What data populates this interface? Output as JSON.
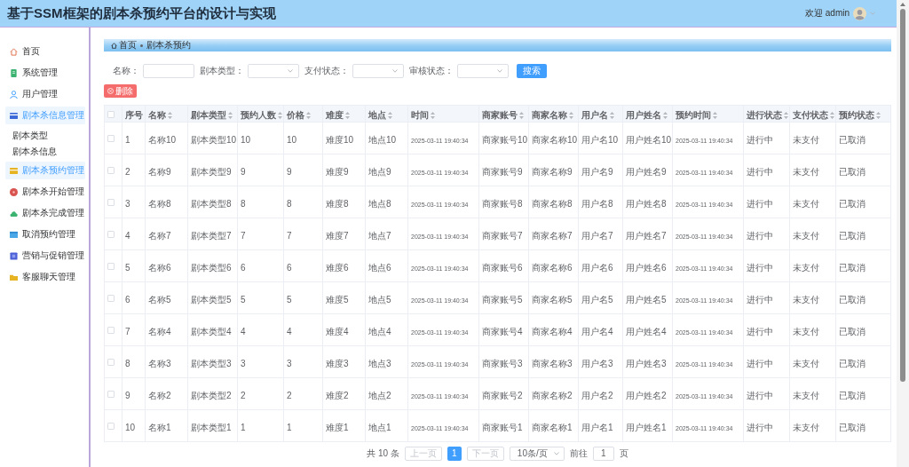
{
  "header": {
    "title": "基于SSM框架的剧本杀预约平台的设计与实现",
    "welcome": "欢迎 admin"
  },
  "sidebar": {
    "items": [
      {
        "label": "首页",
        "selected": false
      },
      {
        "label": "系统管理",
        "selected": false
      },
      {
        "label": "用户管理",
        "selected": false
      },
      {
        "label": "剧本杀信息管理",
        "selected": true,
        "expanded": true,
        "children": [
          {
            "label": "剧本类型"
          },
          {
            "label": "剧本杀信息"
          }
        ]
      },
      {
        "label": "剧本杀预约管理",
        "selected": true
      },
      {
        "label": "剧本杀开始管理",
        "selected": false
      },
      {
        "label": "剧本杀完成管理",
        "selected": false
      },
      {
        "label": "取消预约管理",
        "selected": false
      },
      {
        "label": "营销与促销管理",
        "selected": false
      },
      {
        "label": "客服聊天管理",
        "selected": false
      }
    ]
  },
  "breadcrumb": {
    "home": "首页",
    "current": "剧本杀预约"
  },
  "filters": [
    {
      "label": "名称：",
      "kind": "input"
    },
    {
      "label": "剧本类型：",
      "kind": "select"
    },
    {
      "label": "支付状态：",
      "kind": "select"
    },
    {
      "label": "审核状态：",
      "kind": "select"
    }
  ],
  "search_button": "搜索",
  "delete_button": "删除",
  "table": {
    "header_checked": false,
    "columns": [
      {
        "label": "序号",
        "sortable": false,
        "kind": "text"
      },
      {
        "label": "名称",
        "sortable": true,
        "kind": "text"
      },
      {
        "label": "剧本类型",
        "sortable": true,
        "kind": "text"
      },
      {
        "label": "预约人数",
        "sortable": true,
        "kind": "text"
      },
      {
        "label": "价格",
        "sortable": true,
        "kind": "text"
      },
      {
        "label": "难度",
        "sortable": true,
        "kind": "text"
      },
      {
        "label": "地点",
        "sortable": true,
        "kind": "text"
      },
      {
        "label": "时间",
        "sortable": true,
        "kind": "datetime"
      },
      {
        "label": "商家账号",
        "sortable": true,
        "kind": "text"
      },
      {
        "label": "商家名称",
        "sortable": true,
        "kind": "text"
      },
      {
        "label": "用户名",
        "sortable": true,
        "kind": "text"
      },
      {
        "label": "用户姓名",
        "sortable": true,
        "kind": "text"
      },
      {
        "label": "预约时间",
        "sortable": true,
        "kind": "datetime"
      },
      {
        "label": "进行状态",
        "sortable": true,
        "kind": "text"
      },
      {
        "label": "支付状态",
        "sortable": true,
        "kind": "text"
      },
      {
        "label": "预约状态",
        "sortable": true,
        "kind": "text"
      }
    ],
    "rows": [
      {
        "checked": false,
        "cells": [
          "1",
          "名称10",
          "剧本类型10",
          "10",
          "10",
          "难度10",
          "地点10",
          "2025-03-11 19:40:34",
          "商家账号10",
          "商家名称10",
          "用户名10",
          "用户姓名10",
          "2025-03-11 19:40:34",
          "进行中",
          "未支付",
          "已取消"
        ]
      },
      {
        "checked": false,
        "cells": [
          "2",
          "名称9",
          "剧本类型9",
          "9",
          "9",
          "难度9",
          "地点9",
          "2025-03-11 19:40:34",
          "商家账号9",
          "商家名称9",
          "用户名9",
          "用户姓名9",
          "2025-03-11 19:40:34",
          "进行中",
          "未支付",
          "已取消"
        ]
      },
      {
        "checked": false,
        "cells": [
          "3",
          "名称8",
          "剧本类型8",
          "8",
          "8",
          "难度8",
          "地点8",
          "2025-03-11 19:40:34",
          "商家账号8",
          "商家名称8",
          "用户名8",
          "用户姓名8",
          "2025-03-11 19:40:34",
          "进行中",
          "未支付",
          "已取消"
        ]
      },
      {
        "checked": false,
        "cells": [
          "4",
          "名称7",
          "剧本类型7",
          "7",
          "7",
          "难度7",
          "地点7",
          "2025-03-11 19:40:34",
          "商家账号7",
          "商家名称7",
          "用户名7",
          "用户姓名7",
          "2025-03-11 19:40:34",
          "进行中",
          "未支付",
          "已取消"
        ]
      },
      {
        "checked": false,
        "cells": [
          "5",
          "名称6",
          "剧本类型6",
          "6",
          "6",
          "难度6",
          "地点6",
          "2025-03-11 19:40:34",
          "商家账号6",
          "商家名称6",
          "用户名6",
          "用户姓名6",
          "2025-03-11 19:40:34",
          "进行中",
          "未支付",
          "已取消"
        ]
      },
      {
        "checked": false,
        "cells": [
          "6",
          "名称5",
          "剧本类型5",
          "5",
          "5",
          "难度5",
          "地点5",
          "2025-03-11 19:40:34",
          "商家账号5",
          "商家名称5",
          "用户名5",
          "用户姓名5",
          "2025-03-11 19:40:34",
          "进行中",
          "未支付",
          "已取消"
        ]
      },
      {
        "checked": false,
        "cells": [
          "7",
          "名称4",
          "剧本类型4",
          "4",
          "4",
          "难度4",
          "地点4",
          "2025-03-11 19:40:34",
          "商家账号4",
          "商家名称4",
          "用户名4",
          "用户姓名4",
          "2025-03-11 19:40:34",
          "进行中",
          "未支付",
          "已取消"
        ]
      },
      {
        "checked": false,
        "cells": [
          "8",
          "名称3",
          "剧本类型3",
          "3",
          "3",
          "难度3",
          "地点3",
          "2025-03-11 19:40:34",
          "商家账号3",
          "商家名称3",
          "用户名3",
          "用户姓名3",
          "2025-03-11 19:40:34",
          "进行中",
          "未支付",
          "已取消"
        ]
      },
      {
        "checked": false,
        "cells": [
          "9",
          "名称2",
          "剧本类型2",
          "2",
          "2",
          "难度2",
          "地点2",
          "2025-03-11 19:40:34",
          "商家账号2",
          "商家名称2",
          "用户名2",
          "用户姓名2",
          "2025-03-11 19:40:34",
          "进行中",
          "未支付",
          "已取消"
        ]
      },
      {
        "checked": false,
        "cells": [
          "10",
          "名称1",
          "剧本类型1",
          "1",
          "1",
          "难度1",
          "地点1",
          "2025-03-11 19:40:34",
          "商家账号1",
          "商家名称1",
          "用户名1",
          "用户姓名1",
          "2025-03-11 19:40:34",
          "进行中",
          "未支付",
          "已取消"
        ]
      }
    ]
  },
  "pagination": {
    "total": "共 10 条",
    "prev": {
      "label": "上一页",
      "disabled": true
    },
    "pages": [
      {
        "label": "1",
        "selected": true
      }
    ],
    "next": {
      "label": "下一页",
      "disabled": true
    },
    "page_size": "10条/页",
    "goto_label": "前往",
    "goto_value": "1",
    "goto_suffix": "页"
  }
}
